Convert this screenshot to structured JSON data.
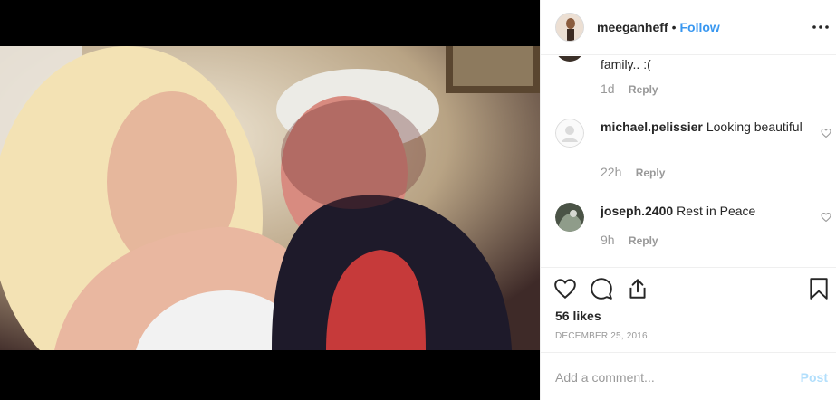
{
  "post": {
    "username": "meeganheff",
    "separator": "•",
    "follow_label": "Follow",
    "more_icon": "more-options-icon",
    "likes": "56 likes",
    "date": "DECEMBER 25, 2016"
  },
  "comments": [
    {
      "user": "",
      "text": "family.. :(",
      "time": "1d",
      "reply": "Reply"
    },
    {
      "user": "michael.pelissier",
      "text": "Looking beautiful",
      "time": "22h",
      "reply": "Reply"
    },
    {
      "user": "joseph.2400",
      "text": "Rest in Peace",
      "time": "9h",
      "reply": "Reply"
    }
  ],
  "composer": {
    "placeholder": "Add a comment...",
    "post_label": "Post"
  },
  "colors": {
    "link": "#3897f0",
    "muted": "#999999",
    "post_disabled": "#b2dffc"
  }
}
